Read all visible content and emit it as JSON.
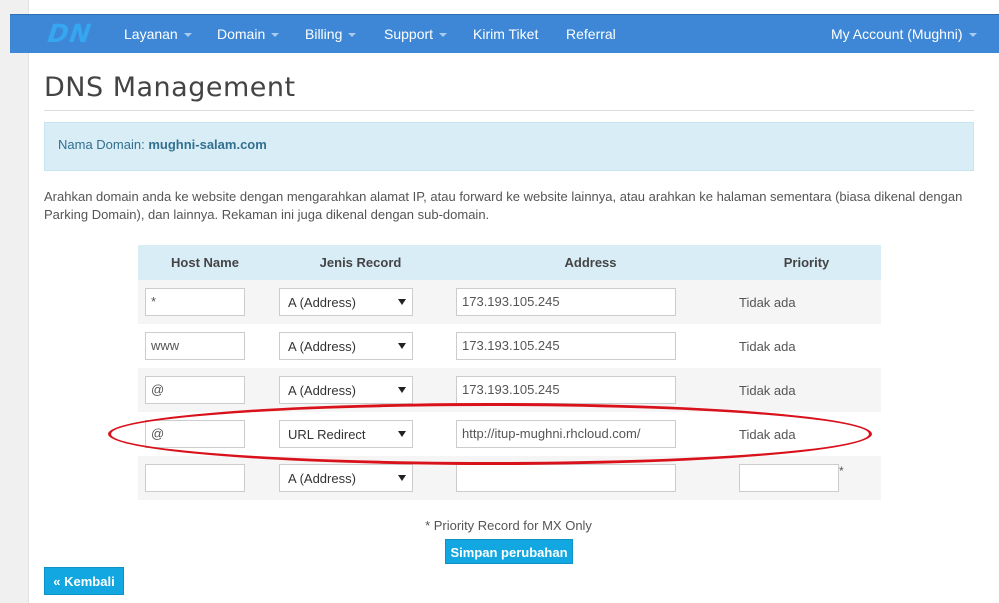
{
  "navbar": {
    "logo": "DN",
    "items": [
      {
        "label": "Layanan",
        "dropdown": true
      },
      {
        "label": "Domain",
        "dropdown": true
      },
      {
        "label": "Billing",
        "dropdown": true
      },
      {
        "label": "Support",
        "dropdown": true
      },
      {
        "label": "Kirim Tiket",
        "dropdown": false
      },
      {
        "label": "Referral",
        "dropdown": false
      }
    ],
    "account": "My Account (Mughni)"
  },
  "page": {
    "title": "DNS Management",
    "domain_label": "Nama Domain:",
    "domain_name": "mughni-salam.com",
    "description": "Arahkan domain anda ke website dengan mengarahkan alamat IP, atau forward ke website lainnya, atau arahkan ke halaman sementara (biasa dikenal dengan Parking Domain), dan lainnya. Rekaman ini juga dikenal dengan sub-domain."
  },
  "table": {
    "headers": [
      "Host Name",
      "Jenis Record",
      "Address",
      "Priority"
    ],
    "rows": [
      {
        "host": "*",
        "type": "A (Address)",
        "address": "173.193.105.245",
        "priority": "Tidak ada"
      },
      {
        "host": "www",
        "type": "A (Address)",
        "address": "173.193.105.245",
        "priority": "Tidak ada"
      },
      {
        "host": "@",
        "type": "A (Address)",
        "address": "173.193.105.245",
        "priority": "Tidak ada"
      },
      {
        "host": "@",
        "type": "URL Redirect",
        "address": "http://itup-mughni.rhcloud.com/",
        "priority": "Tidak ada"
      },
      {
        "host": "",
        "type": "A (Address)",
        "address": "",
        "priority": ""
      }
    ],
    "priority_star": "*"
  },
  "footer": {
    "note": "* Priority Record for MX Only",
    "save_label": "Simpan perubahan",
    "back_label": "« Kembali"
  },
  "annotation_color": "#d9111b",
  "accent_color": "#3d87d6"
}
